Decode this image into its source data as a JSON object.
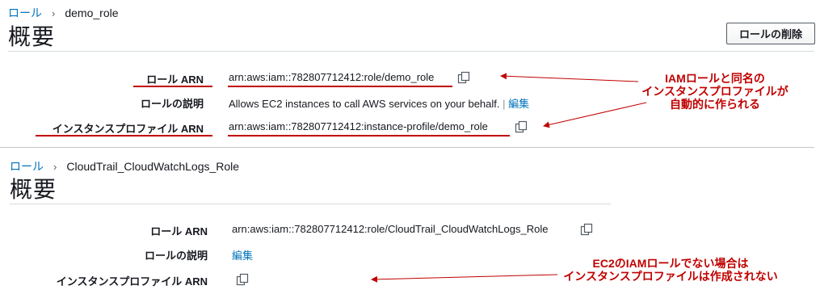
{
  "section1": {
    "breadcrumb": {
      "roles_link": "ロール",
      "separator": "›",
      "current": "demo_role"
    },
    "title": "概要",
    "delete_button": "ロールの削除",
    "fields": {
      "role_arn_label": "ロール ARN",
      "role_arn_value": "arn:aws:iam::782807712412:role/demo_role",
      "description_label": "ロールの説明",
      "description_value": "Allows EC2 instances to call AWS services on your behalf.",
      "description_sep": "|",
      "edit_label": "編集",
      "profile_arn_label": "インスタンスプロファイル ARN",
      "profile_arn_value": "arn:aws:iam::782807712412:instance-profile/demo_role"
    },
    "annotation": {
      "line1": "IAMロールと同名の",
      "line2": "インスタンスプロファイルが",
      "line3": "自動的に作られる"
    }
  },
  "section2": {
    "breadcrumb": {
      "roles_link": "ロール",
      "separator": "›",
      "current": "CloudTrail_CloudWatchLogs_Role"
    },
    "title": "概要",
    "fields": {
      "role_arn_label": "ロール ARN",
      "role_arn_value": "arn:aws:iam::782807712412:role/CloudTrail_CloudWatchLogs_Role",
      "description_label": "ロールの説明",
      "edit_label": "編集",
      "profile_arn_label": "インスタンスプロファイル ARN"
    },
    "annotation": {
      "line1": "EC2のIAMロールでない場合は",
      "line2": "インスタンスプロファイルは作成されない"
    }
  },
  "colors": {
    "link": "#0073bb",
    "annotation": "#c00000",
    "divider": "#d5dbdb"
  },
  "icons": [
    "copy-icon",
    "arrow-left-icon"
  ]
}
